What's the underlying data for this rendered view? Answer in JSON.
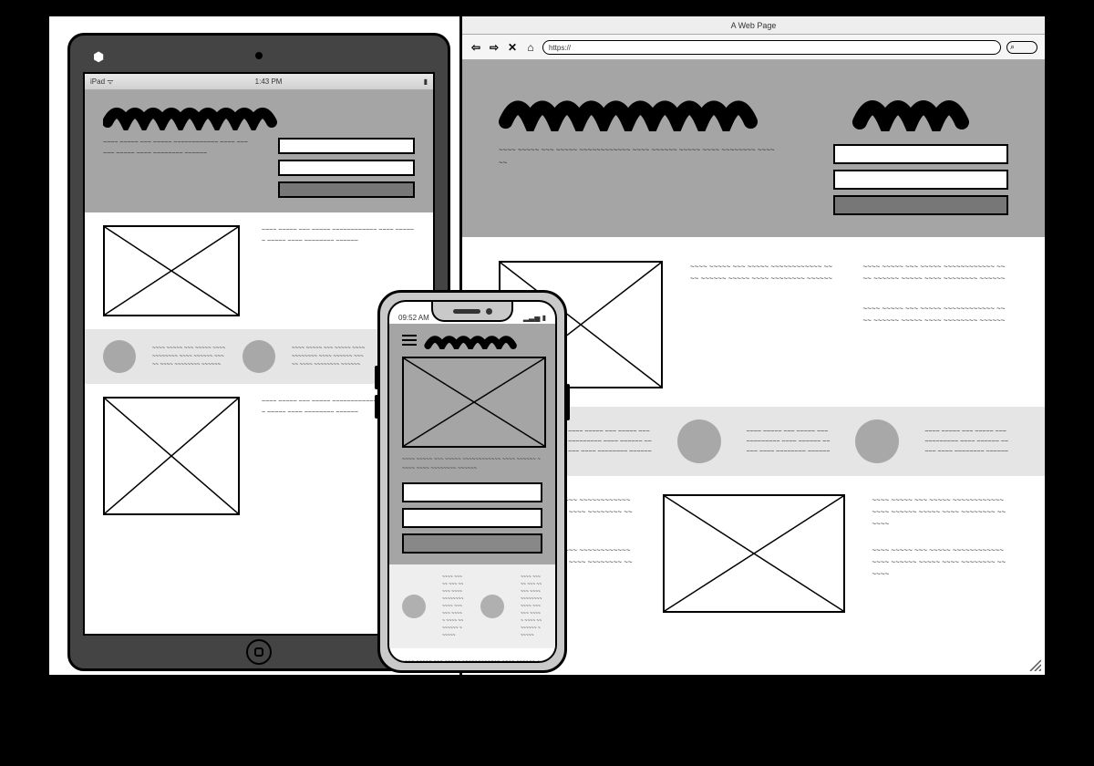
{
  "tablet": {
    "status_left": "iPad ᯤ",
    "status_time": "1:43 PM",
    "status_right": "▮"
  },
  "phone": {
    "status_time": "09:52 AM",
    "status_right": "▂▃▅ ▮"
  },
  "browser": {
    "title": "A Web Page",
    "url_prefix": "https://",
    "url_value": ""
  },
  "placeholders": {
    "lorem": "~~~~ ~~~~~ ~~~ ~~~~~ ~~~~~~~~~~~~ ~~~~ ~~~~~~ ~~~~~ ~~~~ ~~~~~~~~ ~~~~~~"
  },
  "icons": {
    "back": "⇦",
    "forward": "⇨",
    "stop": "✕",
    "home": "⌂",
    "search": "⌕"
  }
}
